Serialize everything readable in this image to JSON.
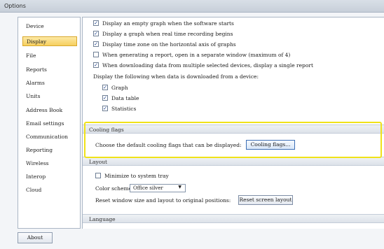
{
  "window": {
    "title": "Options"
  },
  "sidebar": {
    "items": [
      {
        "label": "Device",
        "active": false
      },
      {
        "label": "Display",
        "active": true
      },
      {
        "label": "File",
        "active": false
      },
      {
        "label": "Reports",
        "active": false
      },
      {
        "label": "Alarms",
        "active": false
      },
      {
        "label": "Units",
        "active": false
      },
      {
        "label": "Address Book",
        "active": false
      },
      {
        "label": "Email settings",
        "active": false
      },
      {
        "label": "Communication",
        "active": false
      },
      {
        "label": "Reporting",
        "active": false
      },
      {
        "label": "Wireless",
        "active": false
      },
      {
        "label": "Interop",
        "active": false
      },
      {
        "label": "Cloud",
        "active": false
      }
    ]
  },
  "footer": {
    "about_label": "About"
  },
  "display": {
    "options": [
      {
        "label": "Display an empty graph when the software starts",
        "checked": true
      },
      {
        "label": "Display a graph when real time recording begins",
        "checked": true
      },
      {
        "label": "Display time zone on the horizontal axis of graphs",
        "checked": true
      },
      {
        "label": "When generating a report, open in a separate window (maximum of 4)",
        "checked": false
      },
      {
        "label": "When downloading data from multiple selected devices, display a single report",
        "checked": true
      }
    ],
    "download_heading": "Display the following when data is downloaded from a device:",
    "download_options": [
      {
        "label": "Graph",
        "checked": true
      },
      {
        "label": "Data table",
        "checked": true
      },
      {
        "label": "Statistics",
        "checked": true
      }
    ]
  },
  "cooling_flags": {
    "header": "Cooling flags",
    "description": "Choose the default cooling flags that can be displayed:",
    "button_label": "Cooling flags..."
  },
  "layout": {
    "header": "Layout",
    "minimize_label": "Minimize to system tray",
    "minimize_checked": false,
    "color_scheme_label": "Color scheme:",
    "color_scheme_value": "Office silver",
    "reset_label": "Reset window size and layout to original positions:",
    "reset_button": "Reset screen layout"
  },
  "language": {
    "header": "Language"
  },
  "colors": {
    "highlight": "#f0e219",
    "nav_active": "#f6cf5e",
    "checkmark": "#1b3f8c"
  }
}
